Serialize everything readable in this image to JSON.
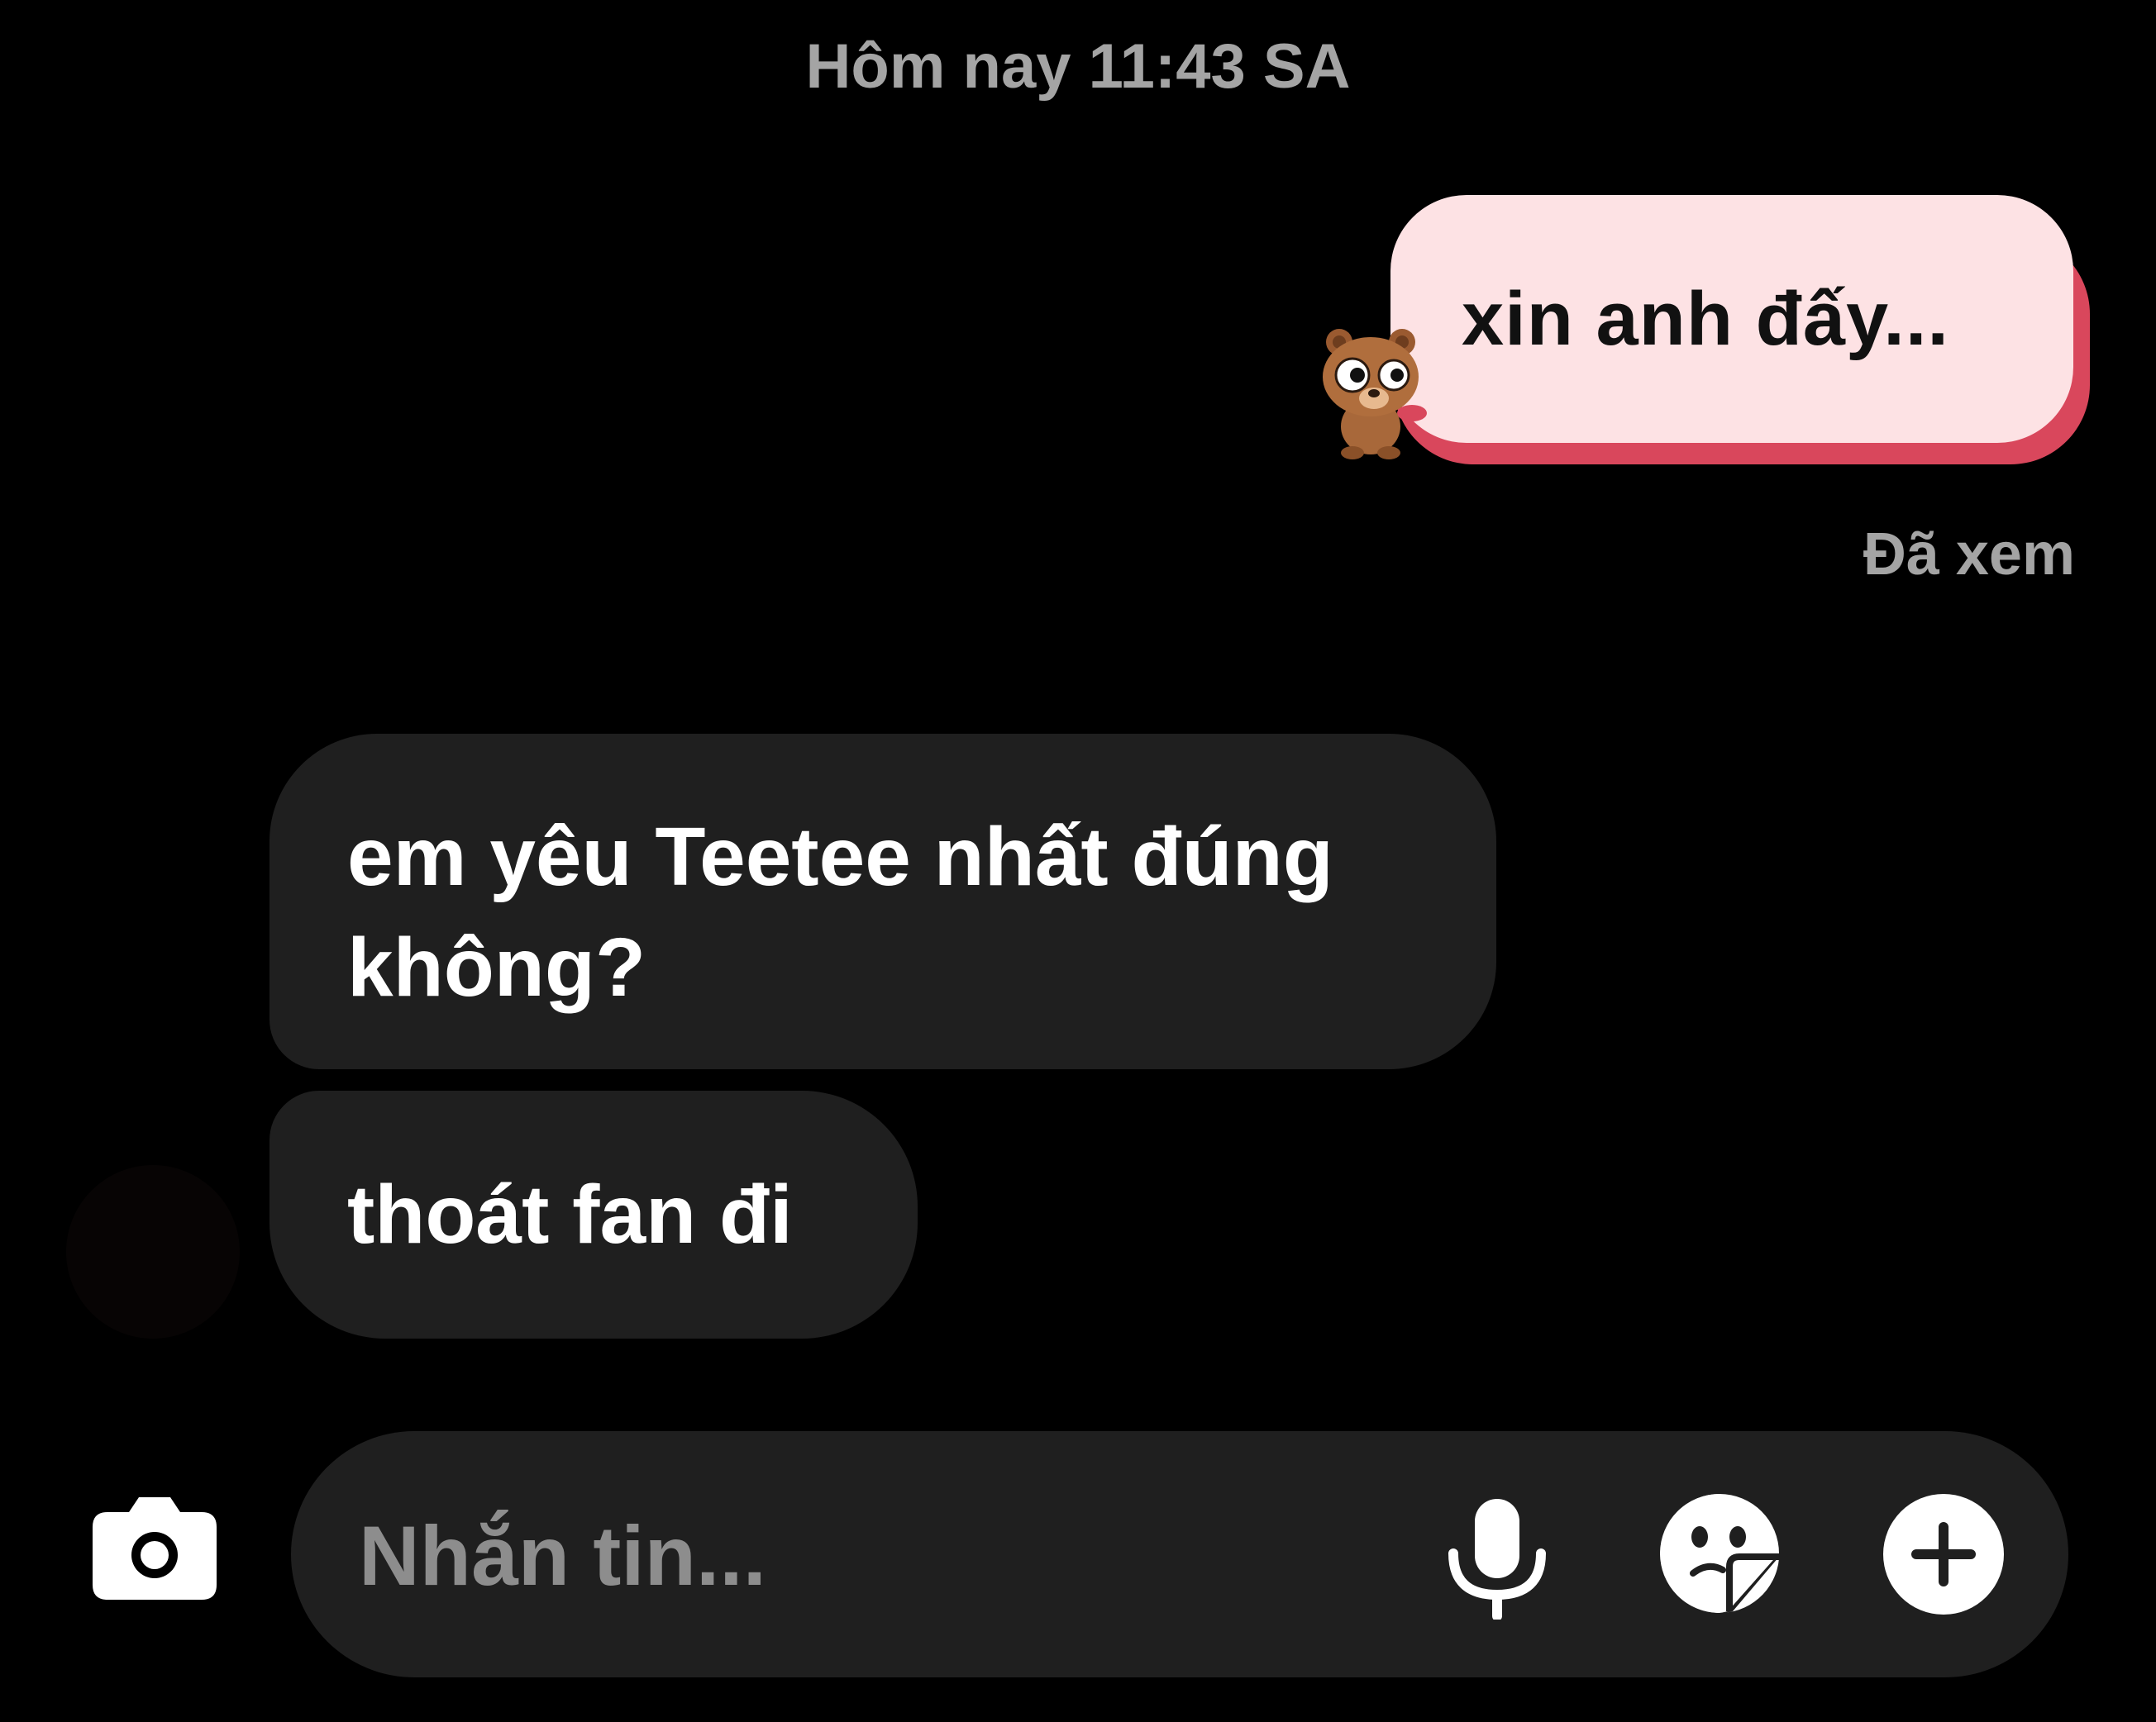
{
  "header": {
    "timestamp": "Hôm nay 11:43 SA"
  },
  "messages": {
    "outgoing": [
      {
        "text": "xin anh đấy...",
        "sticker": "bear-sticker"
      }
    ],
    "seen_status": "Đã xem",
    "incoming": [
      {
        "text": "em yêu Teetee nhất đúng không?"
      },
      {
        "text": "thoát fan đi"
      }
    ]
  },
  "composer": {
    "placeholder": "Nhắn tin...",
    "value": "",
    "icons": [
      "camera-icon",
      "microphone-icon",
      "sticker-icon",
      "plus-icon"
    ]
  },
  "colors": {
    "background": "#000000",
    "incoming_bubble": "#1f1f1f",
    "outgoing_bubble": "#fde2e4",
    "outgoing_accent": "#d9475c",
    "muted_text": "#a4a4a4"
  }
}
